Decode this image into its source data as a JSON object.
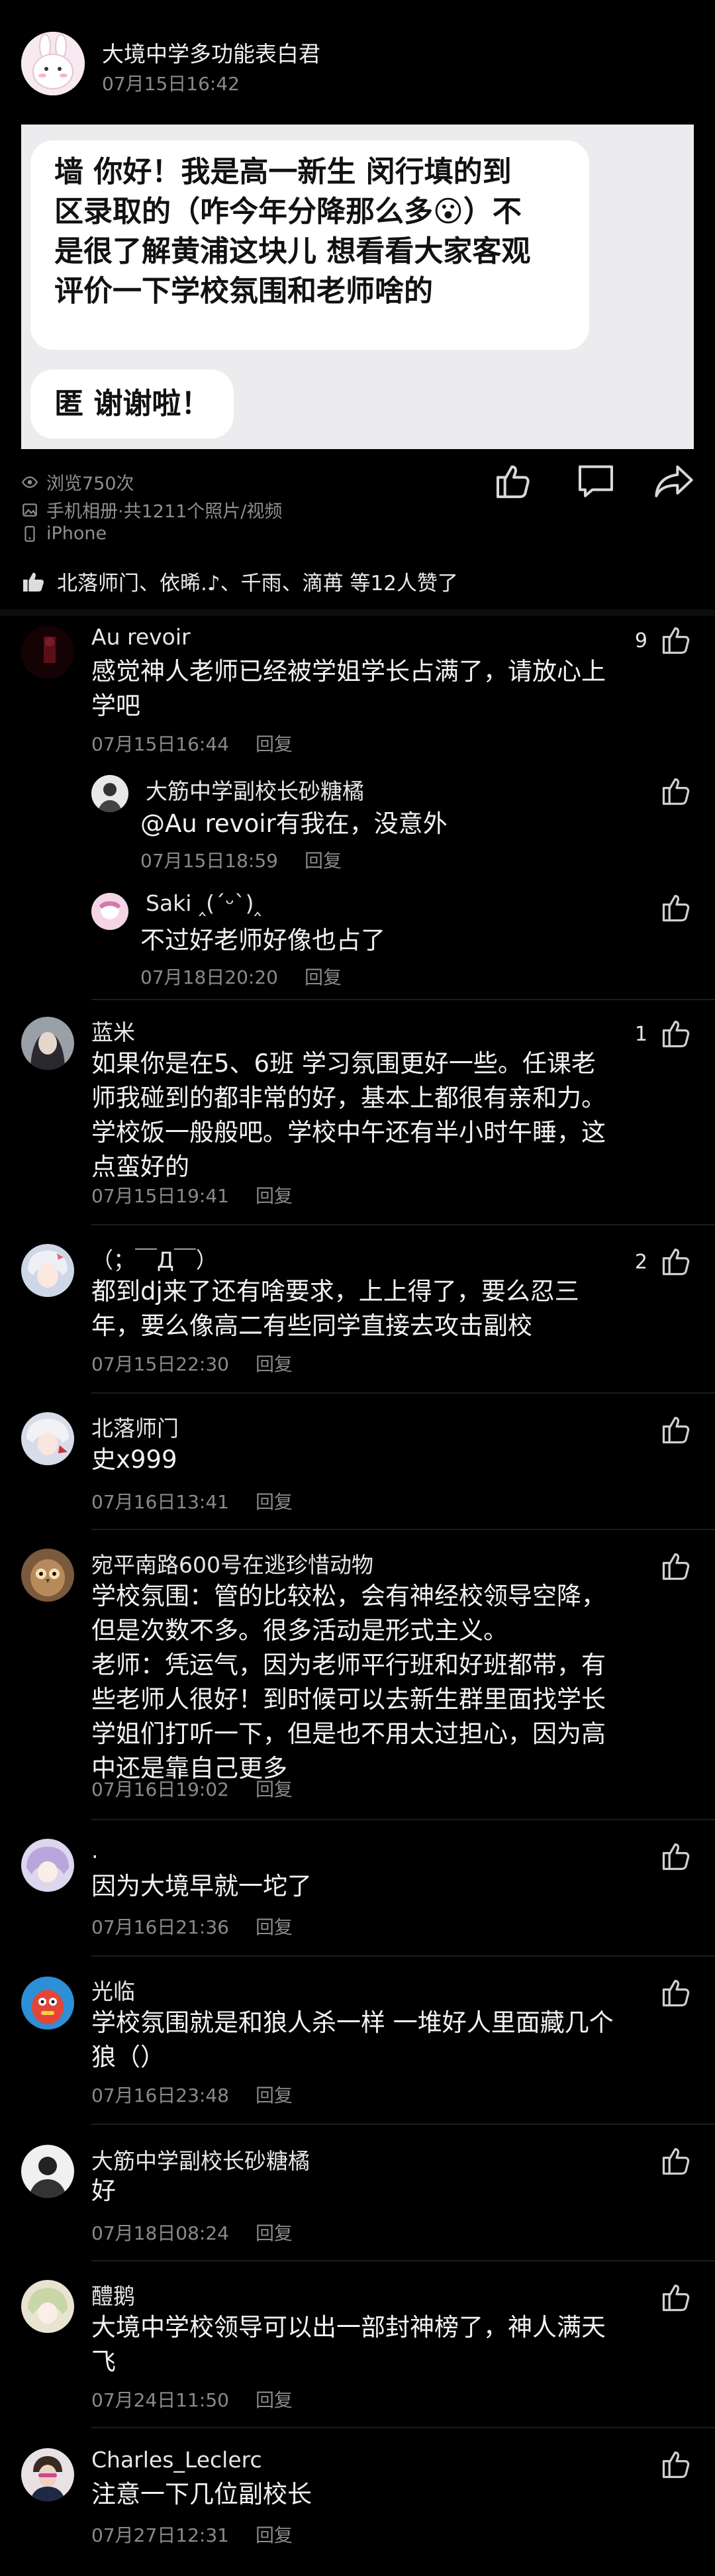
{
  "header": {
    "poster_name": "大境中学多功能表白君",
    "post_time": "07月15日16:42"
  },
  "post": {
    "bubble1_lines": [
      "墙 你好！我是高一新生 闵行填的到",
      "区录取的（咋今年分降那么多😮）不",
      "是很了解黄浦这块儿 想看看大家客观",
      "评价一下学校氛围和老师啥的"
    ],
    "bubble2": "匿 谢谢啦！"
  },
  "meta": {
    "views": "浏览750次",
    "album": "手机相册·共1211个照片/视频",
    "device": "iPhone"
  },
  "likes_summary": "北落师门、依晞.♪、千雨、滴苒 等12人赞了",
  "reply_label": "回复",
  "comments": [
    {
      "name": "Au revoir",
      "lines": [
        "感觉神人老师已经被学姐学长占满了，请放心上",
        "学吧"
      ],
      "time": "07月15日16:44",
      "likes": "9"
    },
    {
      "name": "大筋中学副校长砂糖橘",
      "lines": [
        "@Au revoir有我在，没意外"
      ],
      "time": "07月15日18:59",
      "likes": ""
    },
    {
      "name": "Saki ‸(ˊᵕˋ)‸",
      "lines": [
        "不过好老师好像也占了"
      ],
      "time": "07月18日20:20",
      "likes": ""
    },
    {
      "name": "蓝米",
      "lines": [
        "如果你是在5、6班 学习氛围更好一些。任课老",
        "师我碰到的都非常的好，基本上都很有亲和力。",
        "学校饭一般般吧。学校中午还有半小时午睡，这",
        "点蛮好的"
      ],
      "time": "07月15日19:41",
      "likes": "1"
    },
    {
      "name": "（；￣Д￣）",
      "lines": [
        "都到dj来了还有啥要求，上上得了，要么忍三",
        "年，要么像高二有些同学直接去攻击副校"
      ],
      "time": "07月15日22:30",
      "likes": "2"
    },
    {
      "name": "北落师门",
      "lines": [
        "史x999"
      ],
      "time": "07月16日13:41",
      "likes": ""
    },
    {
      "name": "宛平南路600号在逃珍惜动物",
      "lines": [
        "学校氛围：管的比较松，会有神经校领导空降，",
        "但是次数不多。很多活动是形式主义。",
        "老师：凭运气，因为老师平行班和好班都带，有",
        "些老师人很好！到时候可以去新生群里面找学长",
        "学姐们打听一下，但是也不用太过担心，因为高",
        "中还是靠自己更多"
      ],
      "time": "07月16日19:02",
      "likes": ""
    },
    {
      "name": ".",
      "lines": [
        "因为大境早就一坨了"
      ],
      "time": "07月16日21:36",
      "likes": ""
    },
    {
      "name": "光临",
      "lines": [
        "学校氛围就是和狼人杀一样 一堆好人里面藏几个",
        "狼（）"
      ],
      "time": "07月16日23:48",
      "likes": ""
    },
    {
      "name": "大筋中学副校长砂糖橘",
      "lines": [
        "好"
      ],
      "time": "07月18日08:24",
      "likes": ""
    },
    {
      "name": "醴鹅",
      "lines": [
        "大境中学校领导可以出一部封神榜了，神人满天",
        "飞"
      ],
      "time": "07月24日11:50",
      "likes": ""
    },
    {
      "name": "Charles_Leclerc",
      "lines": [
        "注意一下几位副校长"
      ],
      "time": "07月27日12:31",
      "likes": ""
    }
  ]
}
